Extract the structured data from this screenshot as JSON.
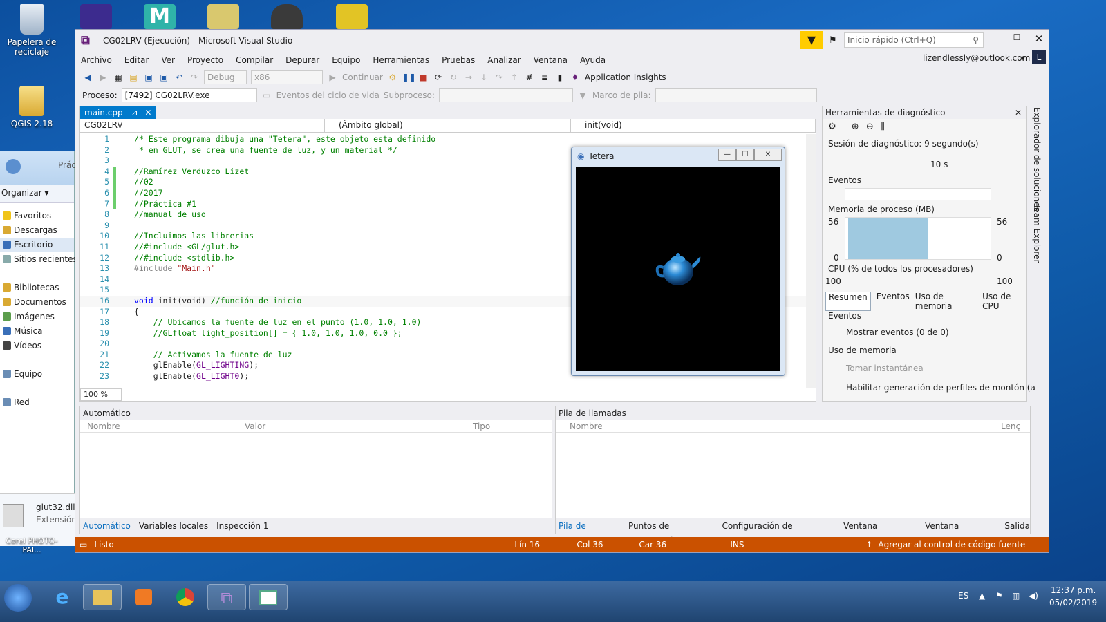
{
  "desktop": {
    "icons": [
      {
        "label": "Papelera de reciclaje"
      },
      {
        "label": "QGIS 2.18"
      },
      {
        "label": "glut32.dll"
      },
      {
        "label": "Extensión"
      },
      {
        "label": "Corel PHOTO-PAI..."
      }
    ]
  },
  "explorer": {
    "breadcrumb": "Prác",
    "organize": "Organizar",
    "nav": [
      {
        "label": "Favoritos"
      },
      {
        "label": "Descargas"
      },
      {
        "label": "Escritorio"
      },
      {
        "label": "Sitios recientes"
      },
      {
        "label": "Bibliotecas"
      },
      {
        "label": "Documentos"
      },
      {
        "label": "Imágenes"
      },
      {
        "label": "Música"
      },
      {
        "label": "Vídeos"
      },
      {
        "label": "Equipo"
      },
      {
        "label": "Red"
      }
    ]
  },
  "vs": {
    "title": "CG02LRV (Ejecución) - Microsoft Visual Studio",
    "quick_launch": "Inicio rápido (Ctrl+Q)",
    "user": "lizendlessly@outlook.com",
    "user_initial": "L",
    "menu": [
      "Archivo",
      "Editar",
      "Ver",
      "Proyecto",
      "Compilar",
      "Depurar",
      "Equipo",
      "Herramientas",
      "Pruebas",
      "Analizar",
      "Ventana",
      "Ayuda"
    ],
    "toolbar": {
      "config": "Debug",
      "platform": "x86",
      "continue": "Continuar",
      "insights": "Application Insights"
    },
    "debugbar": {
      "process_label": "Proceso:",
      "process_value": "[7492] CG02LRV.exe",
      "lifecycle": "Eventos del ciclo de vida",
      "thread_label": "Subproceso:",
      "stack_label": "Marco de pila:"
    },
    "side_tabs": [
      "Explorador de soluciones",
      "Team Explorer"
    ]
  },
  "editor": {
    "tab": "main.cpp",
    "project": "CG02LRV",
    "scope": "(Ámbito global)",
    "member": "init(void)",
    "zoom": "100 %",
    "lines": [
      {
        "n": "1",
        "t": "/* Este programa dibuja una \"Tetera\", este objeto esta definido",
        "c": "cm"
      },
      {
        "n": "2",
        "t": " * en GLUT, se crea una fuente de luz, y un material */",
        "c": "cm"
      },
      {
        "n": "3",
        "t": "",
        "c": ""
      },
      {
        "n": "4",
        "t": "//Ramírez Verduzco Lizet",
        "c": "cm"
      },
      {
        "n": "5",
        "t": "//02",
        "c": "cm"
      },
      {
        "n": "6",
        "t": "//2017",
        "c": "cm"
      },
      {
        "n": "7",
        "t": "//Práctica #1",
        "c": "cm"
      },
      {
        "n": "8",
        "t": "//manual de uso",
        "c": "cm"
      },
      {
        "n": "9",
        "t": "",
        "c": ""
      },
      {
        "n": "10",
        "t": "//Incluimos las librerias",
        "c": "cm"
      },
      {
        "n": "11",
        "t": "//#include <GL/glut.h>",
        "c": "cm"
      },
      {
        "n": "12",
        "t": "//#include <stdlib.h>",
        "c": "cm"
      },
      {
        "n": "13",
        "t": "#include \"Main.h\"",
        "c": "inc"
      },
      {
        "n": "14",
        "t": "",
        "c": ""
      },
      {
        "n": "15",
        "t": "",
        "c": ""
      },
      {
        "n": "16",
        "t": "void init(void) //función de inicio",
        "c": "fn"
      },
      {
        "n": "17",
        "t": "{",
        "c": ""
      },
      {
        "n": "18",
        "t": "    // Ubicamos la fuente de luz en el punto (1.0, 1.0, 1.0)",
        "c": "cm"
      },
      {
        "n": "19",
        "t": "    //GLfloat light_position[] = { 1.0, 1.0, 1.0, 0.0 };",
        "c": "cm"
      },
      {
        "n": "20",
        "t": "",
        "c": ""
      },
      {
        "n": "21",
        "t": "    // Activamos la fuente de luz",
        "c": "cm"
      },
      {
        "n": "22",
        "t": "    glEnable(GL_LIGHTING);",
        "c": "call"
      },
      {
        "n": "23",
        "t": "    glEnable(GL_LIGHT0);",
        "c": "call"
      }
    ]
  },
  "tetera": {
    "title": "Tetera"
  },
  "diag": {
    "title": "Herramientas de diagnóstico",
    "session": "Sesión de diagnóstico: 9 segundo(s)",
    "timeline_mark": "10 s",
    "events": "Eventos",
    "memory": "Memoria de proceso (MB)",
    "mem_max": "56",
    "mem_min": "0",
    "cpu": "CPU (% de todos los procesadores)",
    "cpu_max": "100",
    "tabs": [
      "Resumen",
      "Eventos",
      "Uso de memoria",
      "Uso de CPU"
    ],
    "sec_events": "Eventos",
    "show_events": "Mostrar eventos (0 de 0)",
    "sec_memory": "Uso de memoria",
    "snapshot": "Tomar instantánea",
    "heap": "Habilitar generación de perfiles de montón (a"
  },
  "autos": {
    "title": "Automático",
    "cols": [
      "Nombre",
      "Valor",
      "Tipo"
    ],
    "tabs": [
      "Automático",
      "Variables locales",
      "Inspección 1"
    ]
  },
  "callstack": {
    "title": "Pila de llamadas",
    "cols": [
      "Nombre",
      "Lenç"
    ],
    "tabs": [
      "Pila de llamadas",
      "Puntos de interrupción",
      "Configuración de excepciones",
      "Ventana Comandos",
      "Ventana Inmediato",
      "Salida"
    ]
  },
  "status": {
    "ready": "Listo",
    "line": "Lín 16",
    "col": "Col 36",
    "car": "Car 36",
    "ins": "INS",
    "source_control": "Agregar al control de código fuente"
  },
  "taskbar": {
    "lang": "ES",
    "time": "12:37 p.m.",
    "date": "05/02/2019"
  },
  "colors": {
    "accent": "#007acc",
    "status": "#ca5100",
    "vs_purple": "#68217a"
  }
}
